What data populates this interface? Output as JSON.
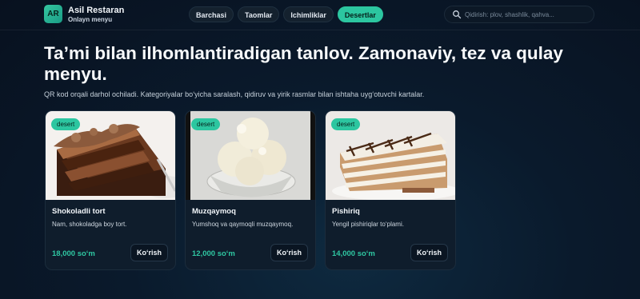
{
  "brand": {
    "logo": "AR",
    "name": "Asil Restaran",
    "subtitle": "Onlayn menyu"
  },
  "tabs": [
    {
      "label": "Barchasi",
      "active": false
    },
    {
      "label": "Taomlar",
      "active": false
    },
    {
      "label": "Ichimliklar",
      "active": false
    },
    {
      "label": "Desertlar",
      "active": true
    }
  ],
  "search": {
    "placeholder": "Qidirish: plov, shashlik, qahva...",
    "icon": "search-icon"
  },
  "hero": {
    "title": "Ta’mi bilan ilhomlantiradigan tanlov. Zamonaviy, tez va qulay menyu.",
    "subtitle": "QR kod orqali darhol ochiladi. Kategoriyalar bo‘yicha saralash, qidiruv va yirik rasmlar bilan ishtaha uyg‘otuvchi kartalar."
  },
  "cards": [
    {
      "badge": "desert",
      "title": "Shokoladli tort",
      "description": "Nam, shokoladga boy tort.",
      "price": "18,000 so‘m",
      "button": "Ko‘rish"
    },
    {
      "badge": "desert",
      "title": "Muzqaymoq",
      "description": "Yumshoq va qaymoqli muzqaymoq.",
      "price": "12,000 so‘m",
      "button": "Ko‘rish"
    },
    {
      "badge": "desert",
      "title": "Pishiriq",
      "description": "Yengil pishiriqlar to‘plami.",
      "price": "14,000 so‘m",
      "button": "Ko‘rish"
    }
  ],
  "colors": {
    "accent": "#2cc6a0",
    "background": "#0a1a2c",
    "price": "#2fc7a2"
  }
}
